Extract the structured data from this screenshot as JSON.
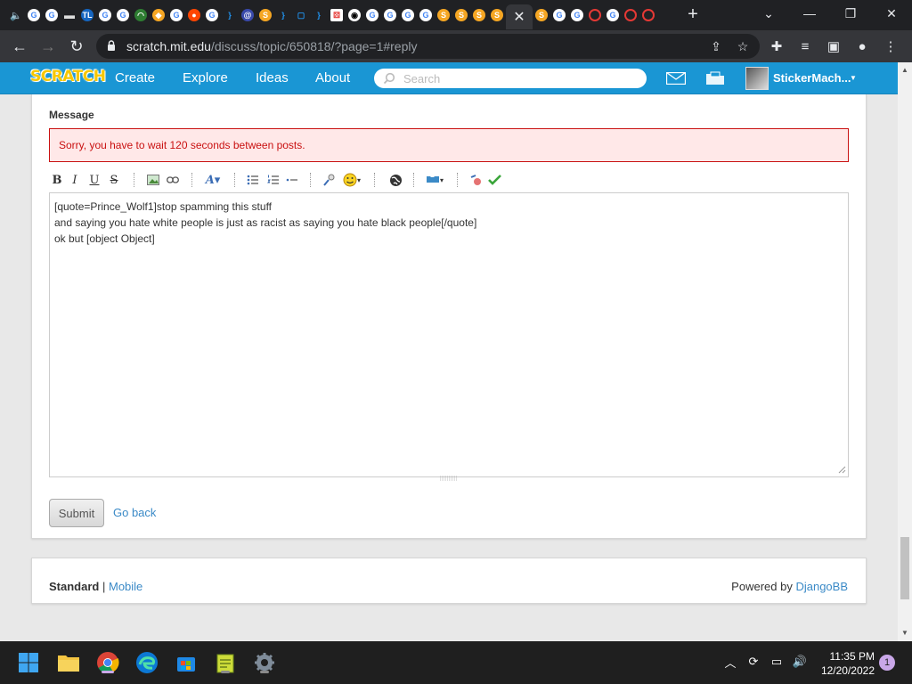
{
  "browser": {
    "active_tab_close": "✕",
    "new_tab": "+",
    "url_host": "scratch.mit.edu",
    "url_path": "/discuss/topic/650818/?page=1#reply"
  },
  "site": {
    "logo": "SCRATCH",
    "nav": {
      "create": "Create",
      "explore": "Explore",
      "ideas": "Ideas",
      "about": "About"
    },
    "search_placeholder": "Search",
    "username": "StickerMach..."
  },
  "form": {
    "message_label": "Message",
    "error": "Sorry, you have to wait 120 seconds between posts.",
    "editor_lines": [
      "[quote=Prince_Wolf1]stop spamming this stuff",
      "and saying you hate white people is just as racist as saying you hate black people[/quote]",
      "ok but [object Object]"
    ],
    "submit_label": "Submit",
    "go_back_label": "Go back"
  },
  "toolbar_buttons": {
    "bold": "B",
    "italic": "I",
    "underline": "U",
    "strike": "S"
  },
  "footer": {
    "standard": "Standard",
    "separator": "|",
    "mobile": "Mobile",
    "powered_by": "Powered by",
    "djangobb": "DjangoBB"
  },
  "system": {
    "time": "11:35 PM",
    "date": "12/20/2022",
    "notification_count": "1"
  },
  "colors": {
    "scratch_blue": "#1a96d4",
    "error_red": "#c91111",
    "link_blue": "#3b8ac7"
  }
}
